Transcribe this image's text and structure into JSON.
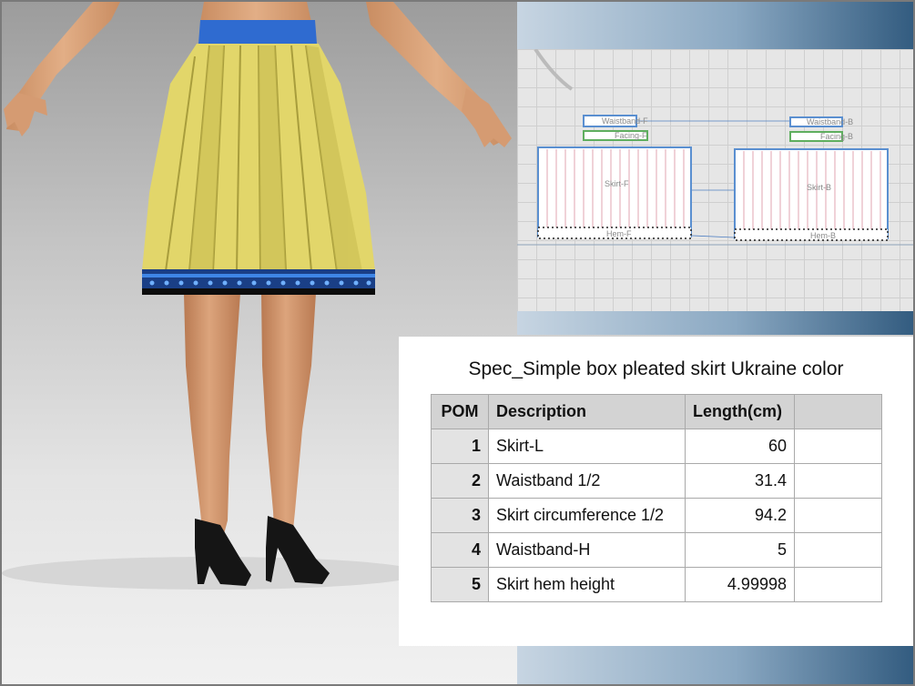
{
  "viewport": {
    "colors": {
      "skirt": "#e2d66a",
      "waistband": "#2f6bd0",
      "hem_border": "#1a3f86",
      "shoes": "#151515",
      "skin": "#d9a37a"
    }
  },
  "pattern": {
    "pieces": [
      {
        "label": "Waistband-F"
      },
      {
        "label": "Facing-F"
      },
      {
        "label": "Waistband-B"
      },
      {
        "label": "Facing-B"
      },
      {
        "label": "Skirt-F"
      },
      {
        "label": "Skirt-B"
      },
      {
        "label": "Hem-F"
      },
      {
        "label": "Hem-B"
      }
    ]
  },
  "spec": {
    "title": "Spec_Simple box pleated skirt Ukraine color",
    "headers": {
      "pom": "POM",
      "description": "Description",
      "length": "Length(cm)",
      "extra": ""
    },
    "rows": [
      {
        "pom": "1",
        "description": "Skirt-L",
        "length": "60"
      },
      {
        "pom": "2",
        "description": "Waistband 1/2",
        "length": "31.4"
      },
      {
        "pom": "3",
        "description": "Skirt circumference 1/2",
        "length": "94.2"
      },
      {
        "pom": "4",
        "description": "Waistband-H",
        "length": "5"
      },
      {
        "pom": "5",
        "description": "Skirt hem height",
        "length": "4.99998"
      }
    ]
  }
}
